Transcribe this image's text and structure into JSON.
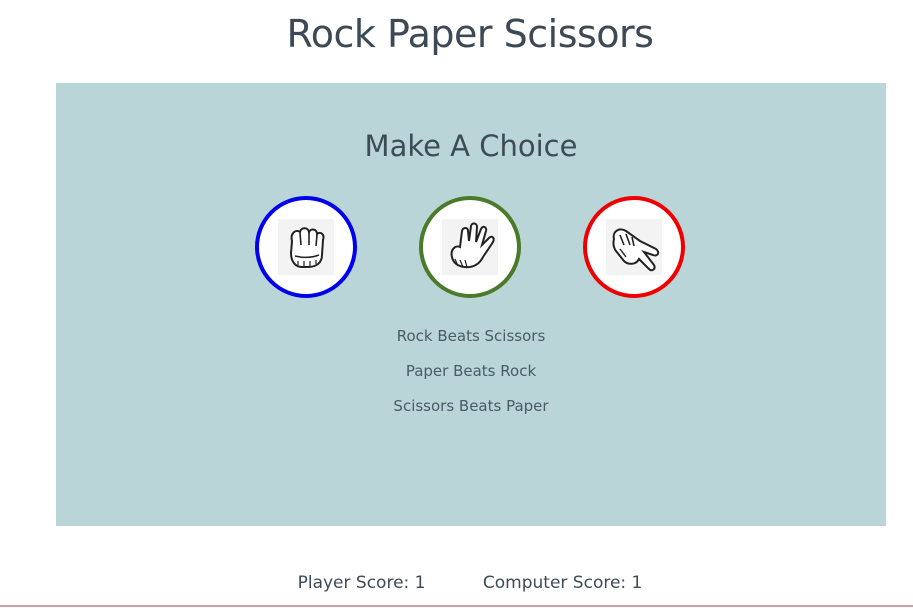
{
  "title": "Rock Paper Scissors",
  "panel": {
    "heading": "Make A Choice",
    "choices": [
      {
        "name": "rock",
        "icon": "rock-fist-icon",
        "border_color": "#0000ee"
      },
      {
        "name": "paper",
        "icon": "paper-hand-icon",
        "border_color": "#4a7a2a"
      },
      {
        "name": "scissors",
        "icon": "scissors-hand-icon",
        "border_color": "#ee0000"
      }
    ],
    "rules": [
      "Rock Beats Scissors",
      "Paper Beats Rock",
      "Scissors Beats Paper"
    ]
  },
  "scores": {
    "player_label": "Player Score: 1",
    "computer_label": "Computer Score: 1"
  },
  "colors": {
    "panel_background": "#b9d5d8",
    "text": "#3d4b57"
  }
}
